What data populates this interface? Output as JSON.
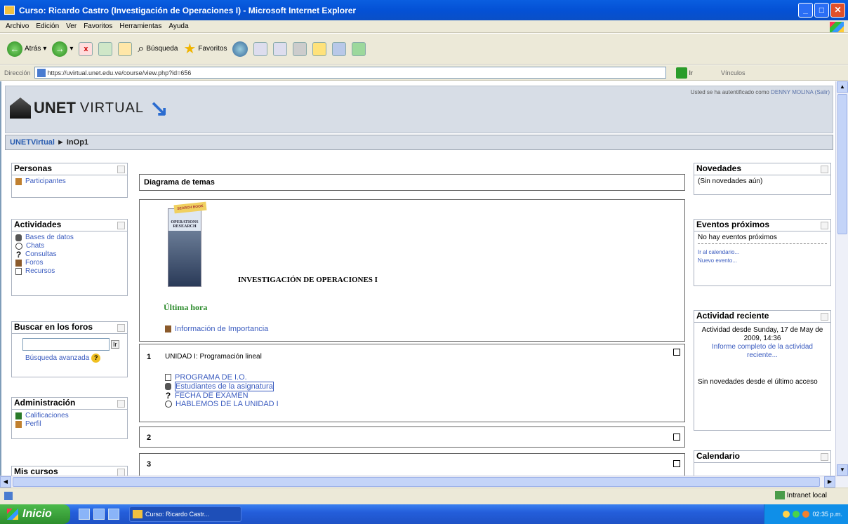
{
  "window": {
    "title": "Curso: Ricardo Castro (Investigación de Operaciones I) - Microsoft Internet Explorer"
  },
  "menu": [
    "Archivo",
    "Edición",
    "Ver",
    "Favoritos",
    "Herramientas",
    "Ayuda"
  ],
  "toolbar": {
    "back": "Atrás",
    "search": "Búsqueda",
    "favorites": "Favoritos"
  },
  "address": {
    "label": "Dirección",
    "url": "https://uvirtual.unet.edu.ve/course/view.php?id=656",
    "go": "Ir",
    "links": "Vínculos"
  },
  "page": {
    "logo_unet": "UNET",
    "logo_virtual": "VIRTUAL",
    "login_text": "Usted se ha autentificado como",
    "login_user": "DENNY MOLINA",
    "login_exit": "(Salir)",
    "breadcrumb_home": "UNETVirtual",
    "breadcrumb_sep": "►",
    "breadcrumb_course": "InOp1"
  },
  "left": {
    "personas": {
      "title": "Personas",
      "items": [
        "Participantes"
      ]
    },
    "actividades": {
      "title": "Actividades",
      "items": [
        "Bases de datos",
        "Chats",
        "Consultas",
        "Foros",
        "Recursos"
      ]
    },
    "buscar": {
      "title": "Buscar en los foros",
      "go": "Ir",
      "advanced": "Búsqueda avanzada"
    },
    "admin": {
      "title": "Administración",
      "items": [
        "Calificaciones",
        "Perfil"
      ]
    },
    "miscursos": {
      "title": "Mis cursos"
    }
  },
  "center": {
    "diagram_title": "Diagrama de temas",
    "book": {
      "ribbon": "SEARCH BOOK",
      "title_line1": "OPERATIONS",
      "title_line2": "RESEARCH"
    },
    "course_title": "INVESTIGACIÓN DE OPERACIONES I",
    "ultima_hora": "Última hora",
    "info_link": "Información de Importancia",
    "sections": [
      {
        "num": "1",
        "summary": "UNIDAD I: Programación lineal",
        "items": [
          "PROGRAMA DE I.O.",
          "Estudiantes de la asignatura",
          "FECHA DE EXAMEN",
          "HABLEMOS DE LA UNIDAD I"
        ]
      },
      {
        "num": "2"
      },
      {
        "num": "3"
      }
    ]
  },
  "right": {
    "novedades": {
      "title": "Novedades",
      "text": "(Sin novedades aún)"
    },
    "eventos": {
      "title": "Eventos próximos",
      "text": "No hay eventos próximos",
      "links": [
        "Ir al calendario...",
        "Nuevo evento..."
      ]
    },
    "actividad": {
      "title": "Actividad reciente",
      "since": "Actividad desde Sunday, 17 de May de 2009, 14:36",
      "report": "Informe completo de la actividad reciente...",
      "none": "Sin novedades desde el último acceso"
    },
    "calendario": {
      "title": "Calendario"
    }
  },
  "status": {
    "zone": "Intranet local"
  },
  "taskbar": {
    "start": "Inicio",
    "task": "Curso: Ricardo Castr...",
    "clock": "02:35 p.m."
  }
}
